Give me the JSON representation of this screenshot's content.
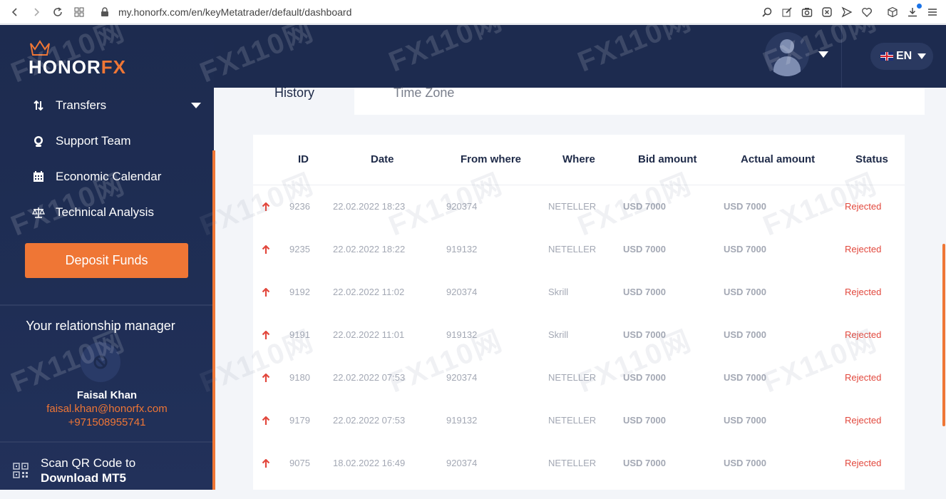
{
  "browser": {
    "url": "my.honorfx.com/en/keyMetatrader/default/dashboard"
  },
  "header": {
    "language": "EN"
  },
  "brand": {
    "name_main": "HONOR",
    "name_accent": "FX",
    "accent_color": "#ef7635",
    "navy_color": "#1d2b4f"
  },
  "sidebar": {
    "items": [
      {
        "label": "Transfers",
        "icon": "transfer-arrows-icon",
        "has_dropdown": true
      },
      {
        "label": "Support Team",
        "icon": "headset-icon"
      },
      {
        "label": "Economic Calendar",
        "icon": "calendar-icon"
      },
      {
        "label": "Technical Analysis",
        "icon": "scales-icon"
      }
    ],
    "deposit_label": "Deposit Funds",
    "manager": {
      "title": "Your relationship manager",
      "name": "Faisal Khan",
      "email": "faisal.khan@honorfx.com",
      "phone": "+971508955741"
    },
    "qr": {
      "line1": "Scan QR Code to",
      "line2": "Download MT5"
    }
  },
  "tabs": [
    {
      "label": "History",
      "active": true
    },
    {
      "label": "Time Zone",
      "active": false
    }
  ],
  "table": {
    "columns": [
      "ID",
      "Date",
      "From where",
      "Where",
      "Bid amount",
      "Actual amount",
      "Status"
    ],
    "rows": [
      {
        "id": "9236",
        "date": "22.02.2022 18:23",
        "from": "920374",
        "where": "NETELLER",
        "bid": "USD 7000",
        "actual": "USD 7000",
        "status": "Rejected"
      },
      {
        "id": "9235",
        "date": "22.02.2022 18:22",
        "from": "919132",
        "where": "NETELLER",
        "bid": "USD 7000",
        "actual": "USD 7000",
        "status": "Rejected"
      },
      {
        "id": "9192",
        "date": "22.02.2022 11:02",
        "from": "920374",
        "where": "Skrill",
        "bid": "USD 7000",
        "actual": "USD 7000",
        "status": "Rejected"
      },
      {
        "id": "9191",
        "date": "22.02.2022 11:01",
        "from": "919132",
        "where": "Skrill",
        "bid": "USD 7000",
        "actual": "USD 7000",
        "status": "Rejected"
      },
      {
        "id": "9180",
        "date": "22.02.2022 07:53",
        "from": "920374",
        "where": "NETELLER",
        "bid": "USD 7000",
        "actual": "USD 7000",
        "status": "Rejected"
      },
      {
        "id": "9179",
        "date": "22.02.2022 07:53",
        "from": "919132",
        "where": "NETELLER",
        "bid": "USD 7000",
        "actual": "USD 7000",
        "status": "Rejected"
      },
      {
        "id": "9075",
        "date": "18.02.2022 16:49",
        "from": "920374",
        "where": "NETELLER",
        "bid": "USD 7000",
        "actual": "USD 7000",
        "status": "Rejected"
      }
    ]
  },
  "watermark": "FX110网"
}
